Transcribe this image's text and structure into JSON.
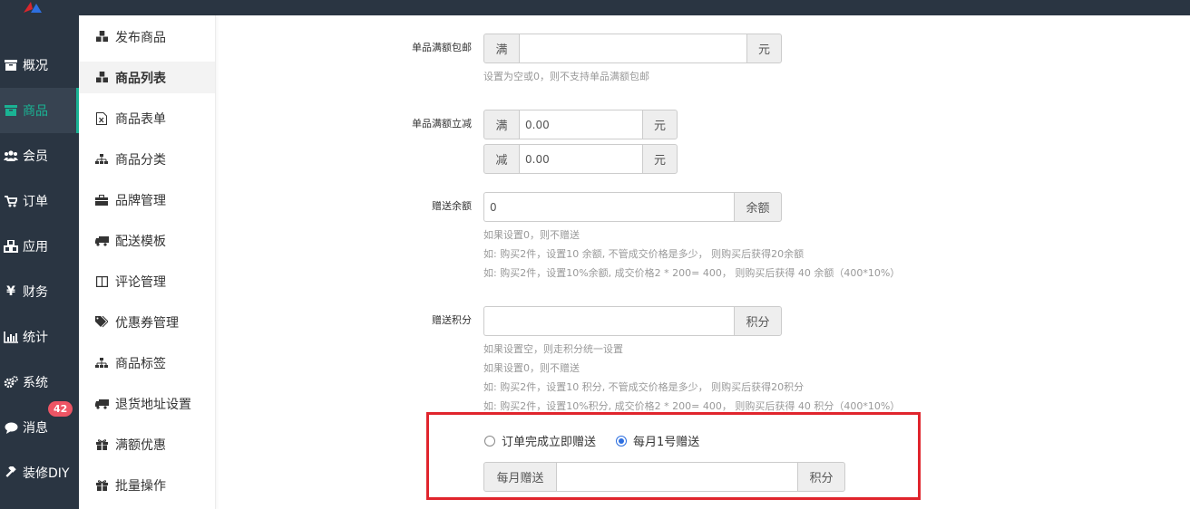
{
  "main_nav": [
    {
      "label": "概况",
      "icon": "archive-icon",
      "active": false
    },
    {
      "label": "商品",
      "icon": "archive-icon",
      "active": true
    },
    {
      "label": "会员",
      "icon": "users-icon",
      "active": false
    },
    {
      "label": "订单",
      "icon": "cart-icon",
      "active": false
    },
    {
      "label": "应用",
      "icon": "cubes-icon",
      "active": false
    },
    {
      "label": "财务",
      "icon": "yen-icon",
      "active": false
    },
    {
      "label": "统计",
      "icon": "bar-chart-icon",
      "active": false
    },
    {
      "label": "系统",
      "icon": "gears-icon",
      "active": false
    },
    {
      "label": "消息",
      "icon": "comment-icon",
      "active": false,
      "badge": "42"
    },
    {
      "label": "装修DIY",
      "icon": "gavel-icon",
      "active": false
    }
  ],
  "sub_nav": [
    {
      "label": "发布商品",
      "icon": "cubes-icon",
      "active": false
    },
    {
      "label": "商品列表",
      "icon": "cubes-icon",
      "active": true
    },
    {
      "label": "商品表单",
      "icon": "excel-file-icon",
      "active": false
    },
    {
      "label": "商品分类",
      "icon": "sitemap-icon",
      "active": false
    },
    {
      "label": "品牌管理",
      "icon": "briefcase-icon",
      "active": false
    },
    {
      "label": "配送模板",
      "icon": "truck-icon",
      "active": false
    },
    {
      "label": "评论管理",
      "icon": "columns-icon",
      "active": false
    },
    {
      "label": "优惠券管理",
      "icon": "tags-icon",
      "active": false
    },
    {
      "label": "商品标签",
      "icon": "sitemap-icon",
      "active": false
    },
    {
      "label": "退货地址设置",
      "icon": "truck-icon",
      "active": false
    },
    {
      "label": "满额优惠",
      "icon": "gift-icon",
      "active": false
    },
    {
      "label": "批量操作",
      "icon": "gift-icon",
      "active": false
    }
  ],
  "form": {
    "free_shipping": {
      "label": "单品满额包邮",
      "prefix": "满",
      "value": "",
      "suffix": "元",
      "help": "设置为空或0，则不支持单品满额包邮"
    },
    "instant_discount": {
      "label": "单品满额立减",
      "full_prefix": "满",
      "full_value": "0.00",
      "full_suffix": "元",
      "minus_prefix": "减",
      "minus_value": "0.00",
      "minus_suffix": "元"
    },
    "gift_balance": {
      "label": "赠送余额",
      "value": "0",
      "suffix": "余额",
      "help": [
        "如果设置0，则不赠送",
        "如: 购买2件，设置10 余额, 不管成交价格是多少， 则购买后获得20余额",
        "如: 购买2件，设置10%余额, 成交价格2 * 200= 400， 则购买后获得 40 余额（400*10%）"
      ]
    },
    "gift_points": {
      "label": "赠送积分",
      "value": "",
      "suffix": "积分",
      "help": [
        "如果设置空，则走积分统一设置",
        "如果设置0，则不赠送",
        "如: 购买2件，设置10 积分, 不管成交价格是多少， 则购买后获得20积分",
        "如: 购买2件，设置10%积分, 成交价格2 * 200= 400， 则购买后获得 40 积分（400*10%）"
      ]
    },
    "gift_timing": {
      "option_immediate": "订单完成立即赠送",
      "option_monthly": "每月1号赠送",
      "selected": "monthly",
      "monthly_prefix": "每月赠送",
      "monthly_value": "",
      "monthly_suffix": "积分"
    }
  },
  "colors": {
    "nav_bg": "#2a3542",
    "accent": "#1ab394",
    "badge": "#ed5565",
    "highlight": "#e0252d"
  }
}
